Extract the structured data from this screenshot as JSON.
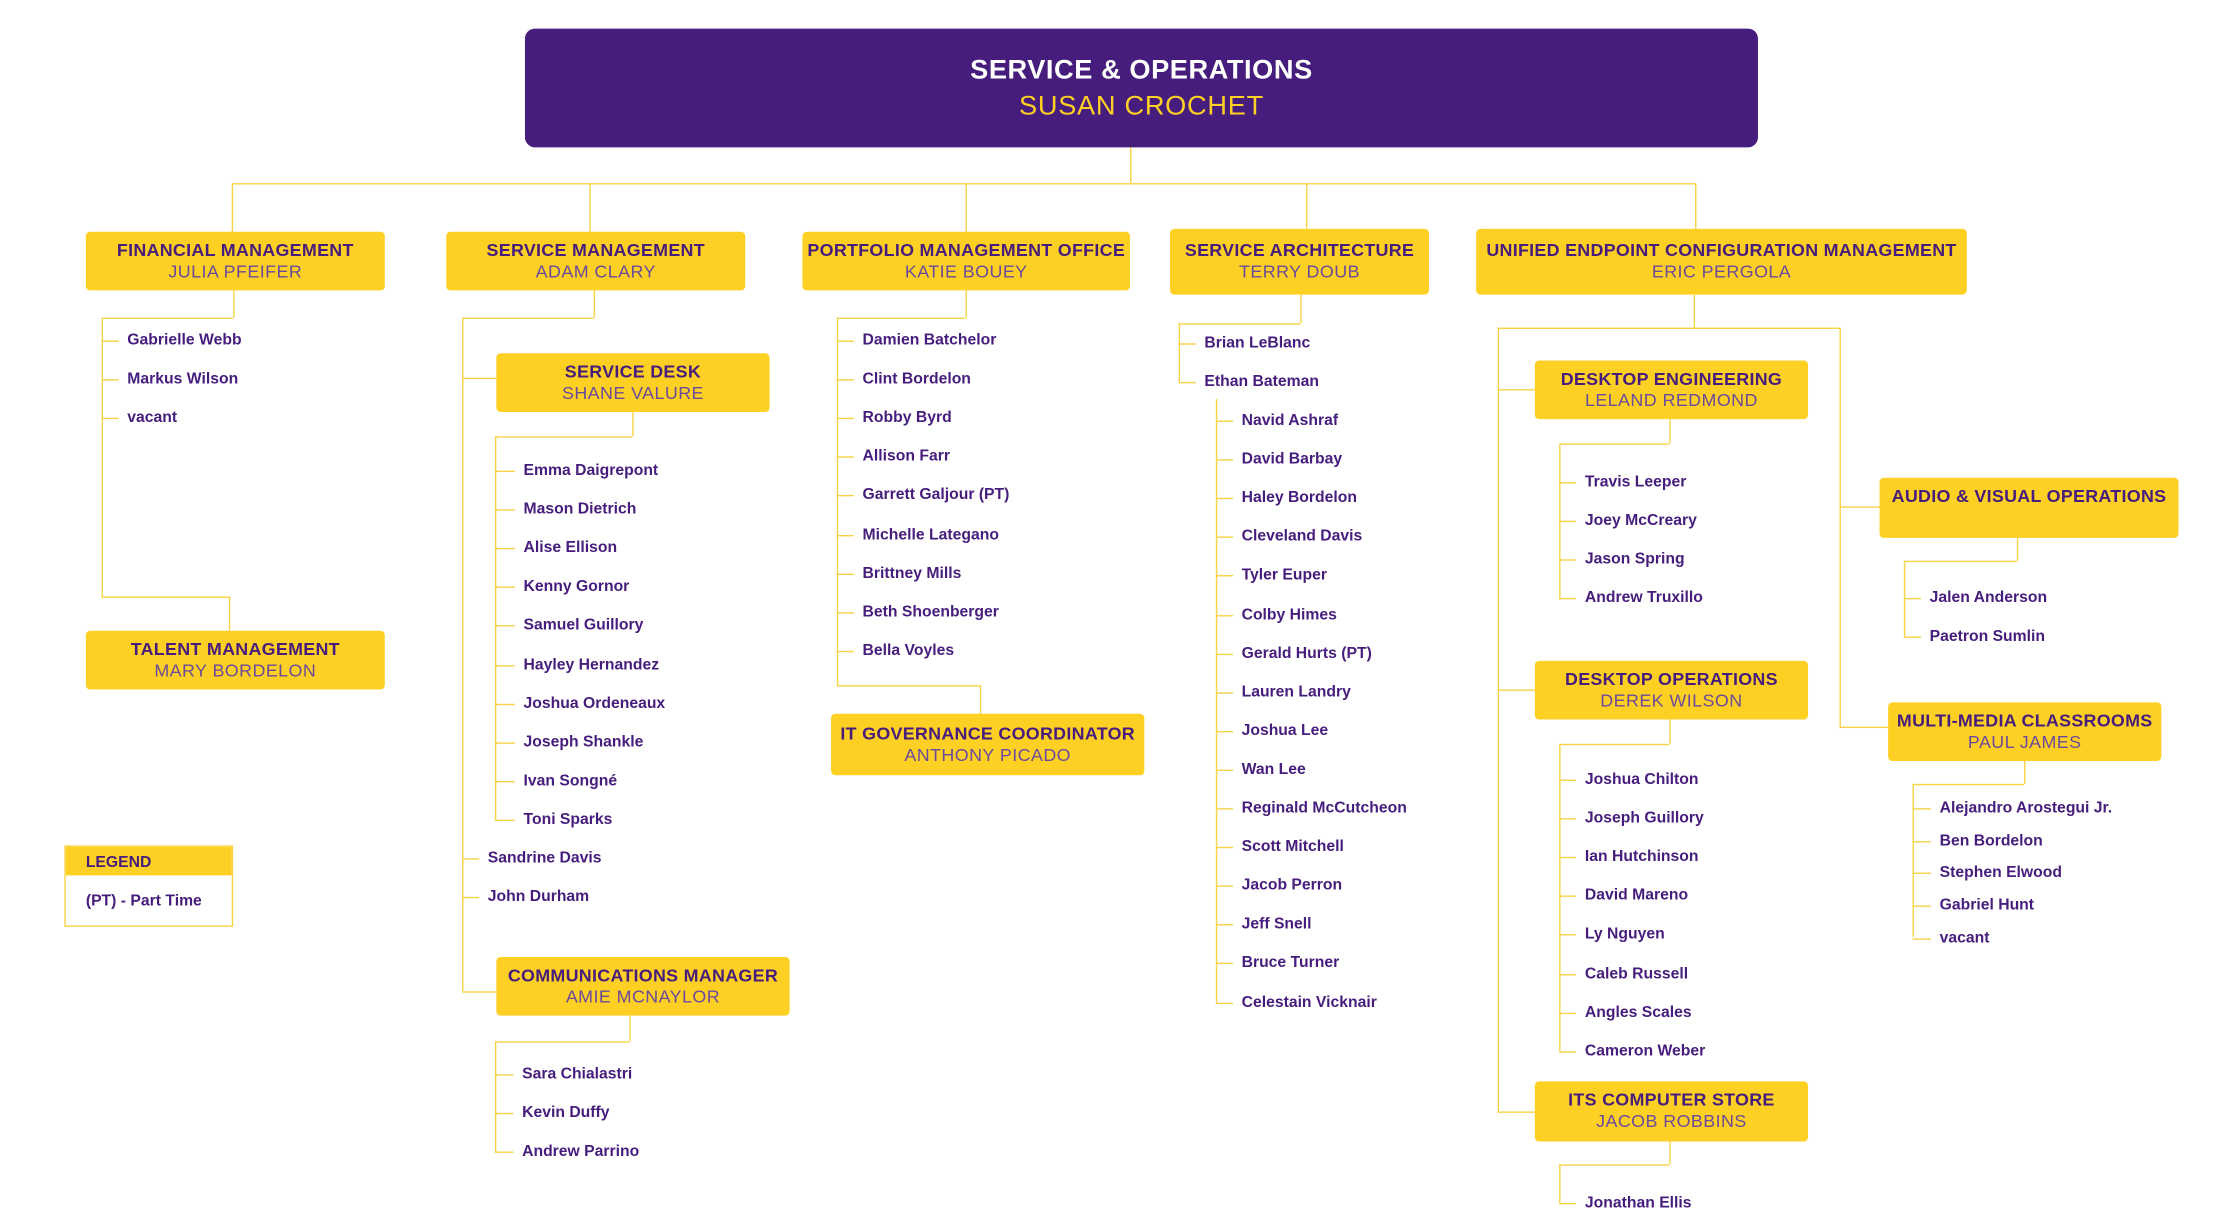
{
  "header": {
    "title": "SERVICE & OPERATIONS",
    "name": "SUSAN CROCHET"
  },
  "colors": {
    "purple": "#461d7c",
    "gold": "#fdd023",
    "line": "#f7d34a"
  },
  "units": {
    "financial": {
      "title": "FINANCIAL MANAGEMENT",
      "name": "JULIA PFEIFER",
      "staff": [
        "Gabrielle Webb",
        "Markus Wilson",
        "vacant"
      ]
    },
    "talent": {
      "title": "TALENT MANAGEMENT",
      "name": "MARY BORDELON"
    },
    "service_mgmt": {
      "title": "SERVICE MANAGEMENT",
      "name": "ADAM CLARY",
      "staff": [
        "Sandrine Davis",
        "John Durham"
      ]
    },
    "service_desk": {
      "title": "SERVICE DESK",
      "name": "SHANE VALURE",
      "staff": [
        "Emma Daigrepont",
        "Mason Dietrich",
        "Alise Ellison",
        "Kenny Gornor",
        "Samuel Guillory",
        "Hayley Hernandez",
        "Joshua Ordeneaux",
        "Joseph Shankle",
        "Ivan Songné",
        "Toni Sparks"
      ]
    },
    "communications": {
      "title": "COMMUNICATIONS MANAGER",
      "name": "AMIE MCNAYLOR",
      "staff": [
        "Sara Chialastri",
        "Kevin Duffy",
        "Andrew Parrino"
      ]
    },
    "pmo": {
      "title": "PORTFOLIO MANAGEMENT OFFICE",
      "name": "KATIE BOUEY",
      "staff": [
        "Damien Batchelor",
        "Clint Bordelon",
        "Robby Byrd",
        "Allison Farr",
        "Garrett Galjour (PT)",
        "Michelle Lategano",
        "Brittney Mills",
        "Beth Shoenberger",
        "Bella Voyles"
      ]
    },
    "it_governance": {
      "title": "IT GOVERNANCE COORDINATOR",
      "name": "ANTHONY PICADO"
    },
    "service_arch": {
      "title": "SERVICE ARCHITECTURE",
      "name": "TERRY DOUB",
      "staff": [
        "Brian LeBlanc",
        "Ethan Bateman"
      ]
    },
    "ethan_team": {
      "staff": [
        "Navid Ashraf",
        "David Barbay",
        "Haley Bordelon",
        "Cleveland Davis",
        "Tyler Euper",
        "Colby Himes",
        "Gerald Hurts (PT)",
        "Lauren Landry",
        "Joshua Lee",
        "Wan Lee",
        "Reginald McCutcheon",
        "Scott Mitchell",
        "Jacob Perron",
        "Jeff Snell",
        "Bruce Turner",
        "Celestain Vicknair"
      ]
    },
    "uecm": {
      "title": "UNIFIED ENDPOINT CONFIGURATION MANAGEMENT",
      "name": "ERIC PERGOLA"
    },
    "desktop_eng": {
      "title": "DESKTOP ENGINEERING",
      "name": "LELAND REDMOND",
      "staff": [
        "Travis Leeper",
        "Joey McCreary",
        "Jason Spring",
        "Andrew Truxillo"
      ]
    },
    "desktop_ops": {
      "title": "DESKTOP OPERATIONS",
      "name": "DEREK WILSON",
      "staff": [
        "Joshua Chilton",
        "Joseph Guillory",
        "Ian Hutchinson",
        "David Mareno",
        "Ly Nguyen",
        "Caleb Russell",
        "Angles Scales",
        "Cameron Weber"
      ]
    },
    "computer_store": {
      "title": "ITS COMPUTER STORE",
      "name": "JACOB ROBBINS",
      "staff": [
        "Jonathan Ellis"
      ]
    },
    "av_ops": {
      "title": "AUDIO & VISUAL OPERATIONS",
      "staff": [
        "Jalen Anderson",
        "Paetron Sumlin"
      ]
    },
    "multimedia": {
      "title": "MULTI-MEDIA CLASSROOMS",
      "name": "PAUL JAMES",
      "staff": [
        "Alejandro Arostegui Jr.",
        "Ben Bordelon",
        "Stephen Elwood",
        "Gabriel Hunt",
        "vacant"
      ]
    }
  },
  "legend": {
    "title": "LEGEND",
    "items": [
      "(PT) - Part Time"
    ]
  }
}
